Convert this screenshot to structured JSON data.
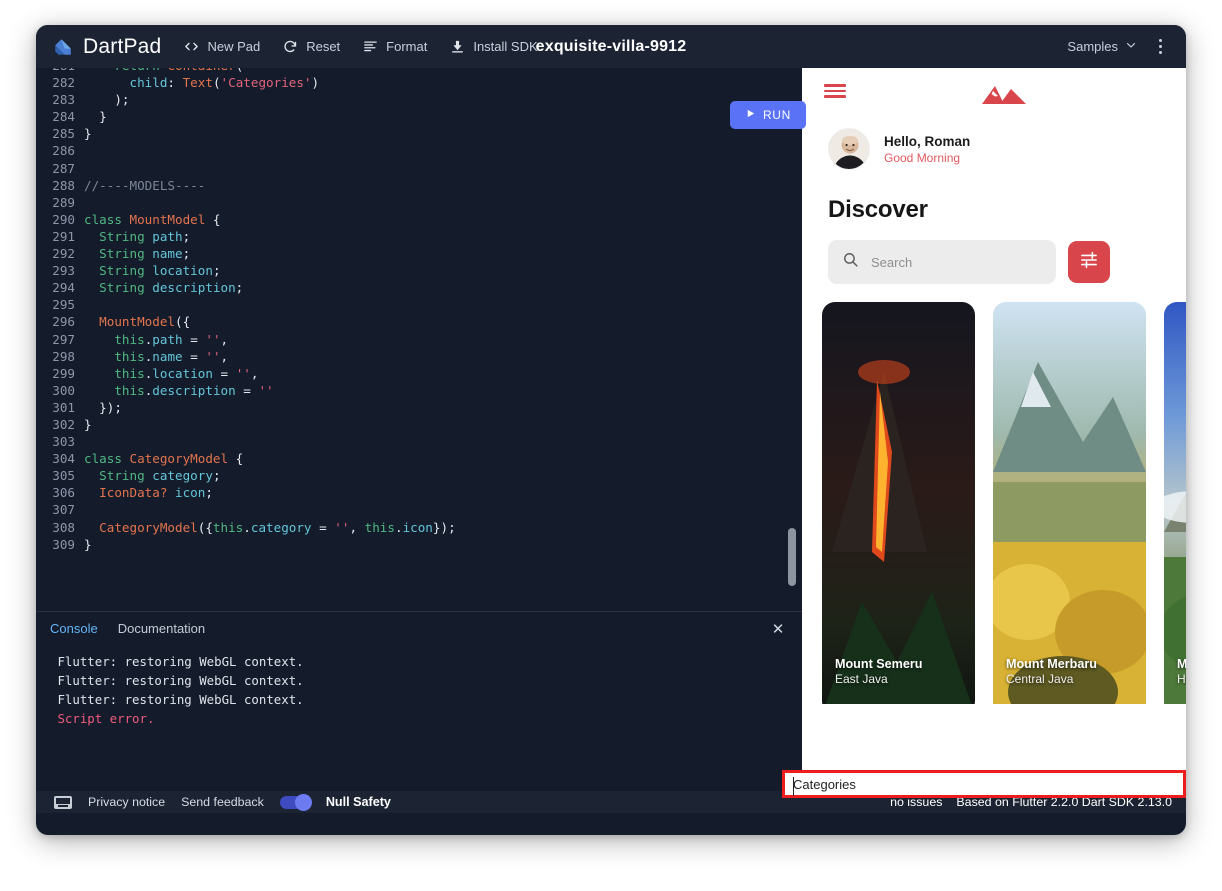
{
  "toolbar": {
    "brand": "DartPad",
    "brand_icon": "dart-logo-icon",
    "items": [
      {
        "label": "New Pad",
        "icon": "code-brackets-icon"
      },
      {
        "label": "Reset",
        "icon": "refresh-icon"
      },
      {
        "label": "Format",
        "icon": "format-align-icon"
      },
      {
        "label": "Install SDK",
        "icon": "download-icon"
      }
    ],
    "pad_title": "exquisite-villa-9912",
    "samples_label": "Samples",
    "samples_caret_icon": "chevron-down-icon",
    "more_icon": "kebab-menu-icon"
  },
  "run_button": {
    "label": "RUN",
    "icon": "play-icon",
    "color": "#5a72f5"
  },
  "editor": {
    "first_visible_line": 281,
    "lines": [
      {
        "no": 281,
        "tokens": [
          {
            "t": "    ",
            "c": "pun"
          },
          {
            "t": "return ",
            "c": "kw"
          },
          {
            "t": "Container",
            "c": "typ"
          },
          {
            "t": "(",
            "c": "pun"
          }
        ]
      },
      {
        "no": 282,
        "tokens": [
          {
            "t": "      ",
            "c": "pun"
          },
          {
            "t": "child",
            "c": "prop"
          },
          {
            "t": ": ",
            "c": "pun"
          },
          {
            "t": "Text",
            "c": "typ"
          },
          {
            "t": "(",
            "c": "pun"
          },
          {
            "t": "'Categories'",
            "c": "str"
          },
          {
            "t": ")",
            "c": "pun"
          }
        ]
      },
      {
        "no": 283,
        "tokens": [
          {
            "t": "    );",
            "c": "pun"
          }
        ]
      },
      {
        "no": 284,
        "tokens": [
          {
            "t": "  }",
            "c": "pun"
          }
        ]
      },
      {
        "no": 285,
        "tokens": [
          {
            "t": "}",
            "c": "pun"
          }
        ]
      },
      {
        "no": 286,
        "tokens": []
      },
      {
        "no": 287,
        "tokens": []
      },
      {
        "no": 288,
        "tokens": [
          {
            "t": "//----MODELS----",
            "c": "cmt"
          }
        ]
      },
      {
        "no": 289,
        "tokens": []
      },
      {
        "no": 290,
        "tokens": [
          {
            "t": "class ",
            "c": "kw"
          },
          {
            "t": "MountModel",
            "c": "typ"
          },
          {
            "t": " {",
            "c": "pun"
          }
        ]
      },
      {
        "no": 291,
        "tokens": [
          {
            "t": "  ",
            "c": "pun"
          },
          {
            "t": "String",
            "c": "kw"
          },
          {
            "t": " ",
            "c": "pun"
          },
          {
            "t": "path",
            "c": "prop"
          },
          {
            "t": ";",
            "c": "pun"
          }
        ]
      },
      {
        "no": 292,
        "tokens": [
          {
            "t": "  ",
            "c": "pun"
          },
          {
            "t": "String",
            "c": "kw"
          },
          {
            "t": " ",
            "c": "pun"
          },
          {
            "t": "name",
            "c": "prop"
          },
          {
            "t": ";",
            "c": "pun"
          }
        ]
      },
      {
        "no": 293,
        "tokens": [
          {
            "t": "  ",
            "c": "pun"
          },
          {
            "t": "String",
            "c": "kw"
          },
          {
            "t": " ",
            "c": "pun"
          },
          {
            "t": "location",
            "c": "prop"
          },
          {
            "t": ";",
            "c": "pun"
          }
        ]
      },
      {
        "no": 294,
        "tokens": [
          {
            "t": "  ",
            "c": "pun"
          },
          {
            "t": "String",
            "c": "kw"
          },
          {
            "t": " ",
            "c": "pun"
          },
          {
            "t": "description",
            "c": "prop"
          },
          {
            "t": ";",
            "c": "pun"
          }
        ]
      },
      {
        "no": 295,
        "tokens": []
      },
      {
        "no": 296,
        "tokens": [
          {
            "t": "  ",
            "c": "pun"
          },
          {
            "t": "MountModel",
            "c": "typ"
          },
          {
            "t": "({",
            "c": "pun"
          }
        ]
      },
      {
        "no": 297,
        "tokens": [
          {
            "t": "    ",
            "c": "pun"
          },
          {
            "t": "this",
            "c": "this"
          },
          {
            "t": ".",
            "c": "pun"
          },
          {
            "t": "path",
            "c": "prop"
          },
          {
            "t": " = ",
            "c": "pun"
          },
          {
            "t": "''",
            "c": "str"
          },
          {
            "t": ",",
            "c": "pun"
          }
        ]
      },
      {
        "no": 298,
        "tokens": [
          {
            "t": "    ",
            "c": "pun"
          },
          {
            "t": "this",
            "c": "this"
          },
          {
            "t": ".",
            "c": "pun"
          },
          {
            "t": "name",
            "c": "prop"
          },
          {
            "t": " = ",
            "c": "pun"
          },
          {
            "t": "''",
            "c": "str"
          },
          {
            "t": ",",
            "c": "pun"
          }
        ]
      },
      {
        "no": 299,
        "tokens": [
          {
            "t": "    ",
            "c": "pun"
          },
          {
            "t": "this",
            "c": "this"
          },
          {
            "t": ".",
            "c": "pun"
          },
          {
            "t": "location",
            "c": "prop"
          },
          {
            "t": " = ",
            "c": "pun"
          },
          {
            "t": "''",
            "c": "str"
          },
          {
            "t": ",",
            "c": "pun"
          }
        ]
      },
      {
        "no": 300,
        "tokens": [
          {
            "t": "    ",
            "c": "pun"
          },
          {
            "t": "this",
            "c": "this"
          },
          {
            "t": ".",
            "c": "pun"
          },
          {
            "t": "description",
            "c": "prop"
          },
          {
            "t": " = ",
            "c": "pun"
          },
          {
            "t": "''",
            "c": "str"
          }
        ]
      },
      {
        "no": 301,
        "tokens": [
          {
            "t": "  });",
            "c": "pun"
          }
        ]
      },
      {
        "no": 302,
        "tokens": [
          {
            "t": "}",
            "c": "pun"
          }
        ]
      },
      {
        "no": 303,
        "tokens": []
      },
      {
        "no": 304,
        "tokens": [
          {
            "t": "class ",
            "c": "kw"
          },
          {
            "t": "CategoryModel",
            "c": "typ"
          },
          {
            "t": " {",
            "c": "pun"
          }
        ]
      },
      {
        "no": 305,
        "tokens": [
          {
            "t": "  ",
            "c": "pun"
          },
          {
            "t": "String",
            "c": "kw"
          },
          {
            "t": " ",
            "c": "pun"
          },
          {
            "t": "category",
            "c": "prop"
          },
          {
            "t": ";",
            "c": "pun"
          }
        ]
      },
      {
        "no": 306,
        "tokens": [
          {
            "t": "  ",
            "c": "pun"
          },
          {
            "t": "IconData?",
            "c": "typ"
          },
          {
            "t": " ",
            "c": "pun"
          },
          {
            "t": "icon",
            "c": "prop"
          },
          {
            "t": ";",
            "c": "pun"
          }
        ]
      },
      {
        "no": 307,
        "tokens": []
      },
      {
        "no": 308,
        "tokens": [
          {
            "t": "  ",
            "c": "pun"
          },
          {
            "t": "CategoryModel",
            "c": "typ"
          },
          {
            "t": "({",
            "c": "pun"
          },
          {
            "t": "this",
            "c": "this"
          },
          {
            "t": ".",
            "c": "pun"
          },
          {
            "t": "category",
            "c": "prop"
          },
          {
            "t": " = ",
            "c": "pun"
          },
          {
            "t": "''",
            "c": "str"
          },
          {
            "t": ", ",
            "c": "pun"
          },
          {
            "t": "this",
            "c": "this"
          },
          {
            "t": ".",
            "c": "pun"
          },
          {
            "t": "icon",
            "c": "prop"
          },
          {
            "t": "});",
            "c": "pun"
          }
        ]
      },
      {
        "no": 309,
        "tokens": [
          {
            "t": "}",
            "c": "pun"
          }
        ]
      }
    ]
  },
  "console": {
    "tabs": [
      {
        "label": "Console",
        "active": true
      },
      {
        "label": "Documentation",
        "active": false
      }
    ],
    "close_icon": "close-icon",
    "output": [
      {
        "text": "Flutter: restoring WebGL context.",
        "error": false
      },
      {
        "text": "Flutter: restoring WebGL context.",
        "error": false
      },
      {
        "text": "Flutter: restoring WebGL context.",
        "error": false
      },
      {
        "text": "Script error.",
        "error": true
      }
    ]
  },
  "statusbar": {
    "keyboard_icon": "keyboard-shortcuts-icon",
    "privacy_label": "Privacy notice",
    "feedback_label": "Send feedback",
    "null_safety_label": "Null Safety",
    "null_safety_on": true,
    "issues_label": "no issues",
    "version_label": "Based on Flutter 2.2.0 Dart SDK 2.13.0"
  },
  "preview": {
    "menu_icon": "hamburger-menu-icon",
    "logo_icon": "mountain-logo-icon",
    "avatar_icon": "user-avatar",
    "greeting_name": "Hello, Roman",
    "greeting_sub": "Good Morning",
    "heading": "Discover",
    "search_placeholder": "Search",
    "search_value": "",
    "search_icon": "search-icon",
    "filter_icon": "filter-sliders-icon",
    "accent_color": "#d8454a",
    "cards": [
      {
        "title": "Mount Semeru",
        "subtitle": "East Java"
      },
      {
        "title": "Mount Merbaru",
        "subtitle": "Central Java"
      },
      {
        "title": "Maun",
        "subtitle": "Hawa"
      }
    ]
  },
  "categories_strip": {
    "label": "Categories",
    "highlight_color": "#ee1c1c"
  }
}
